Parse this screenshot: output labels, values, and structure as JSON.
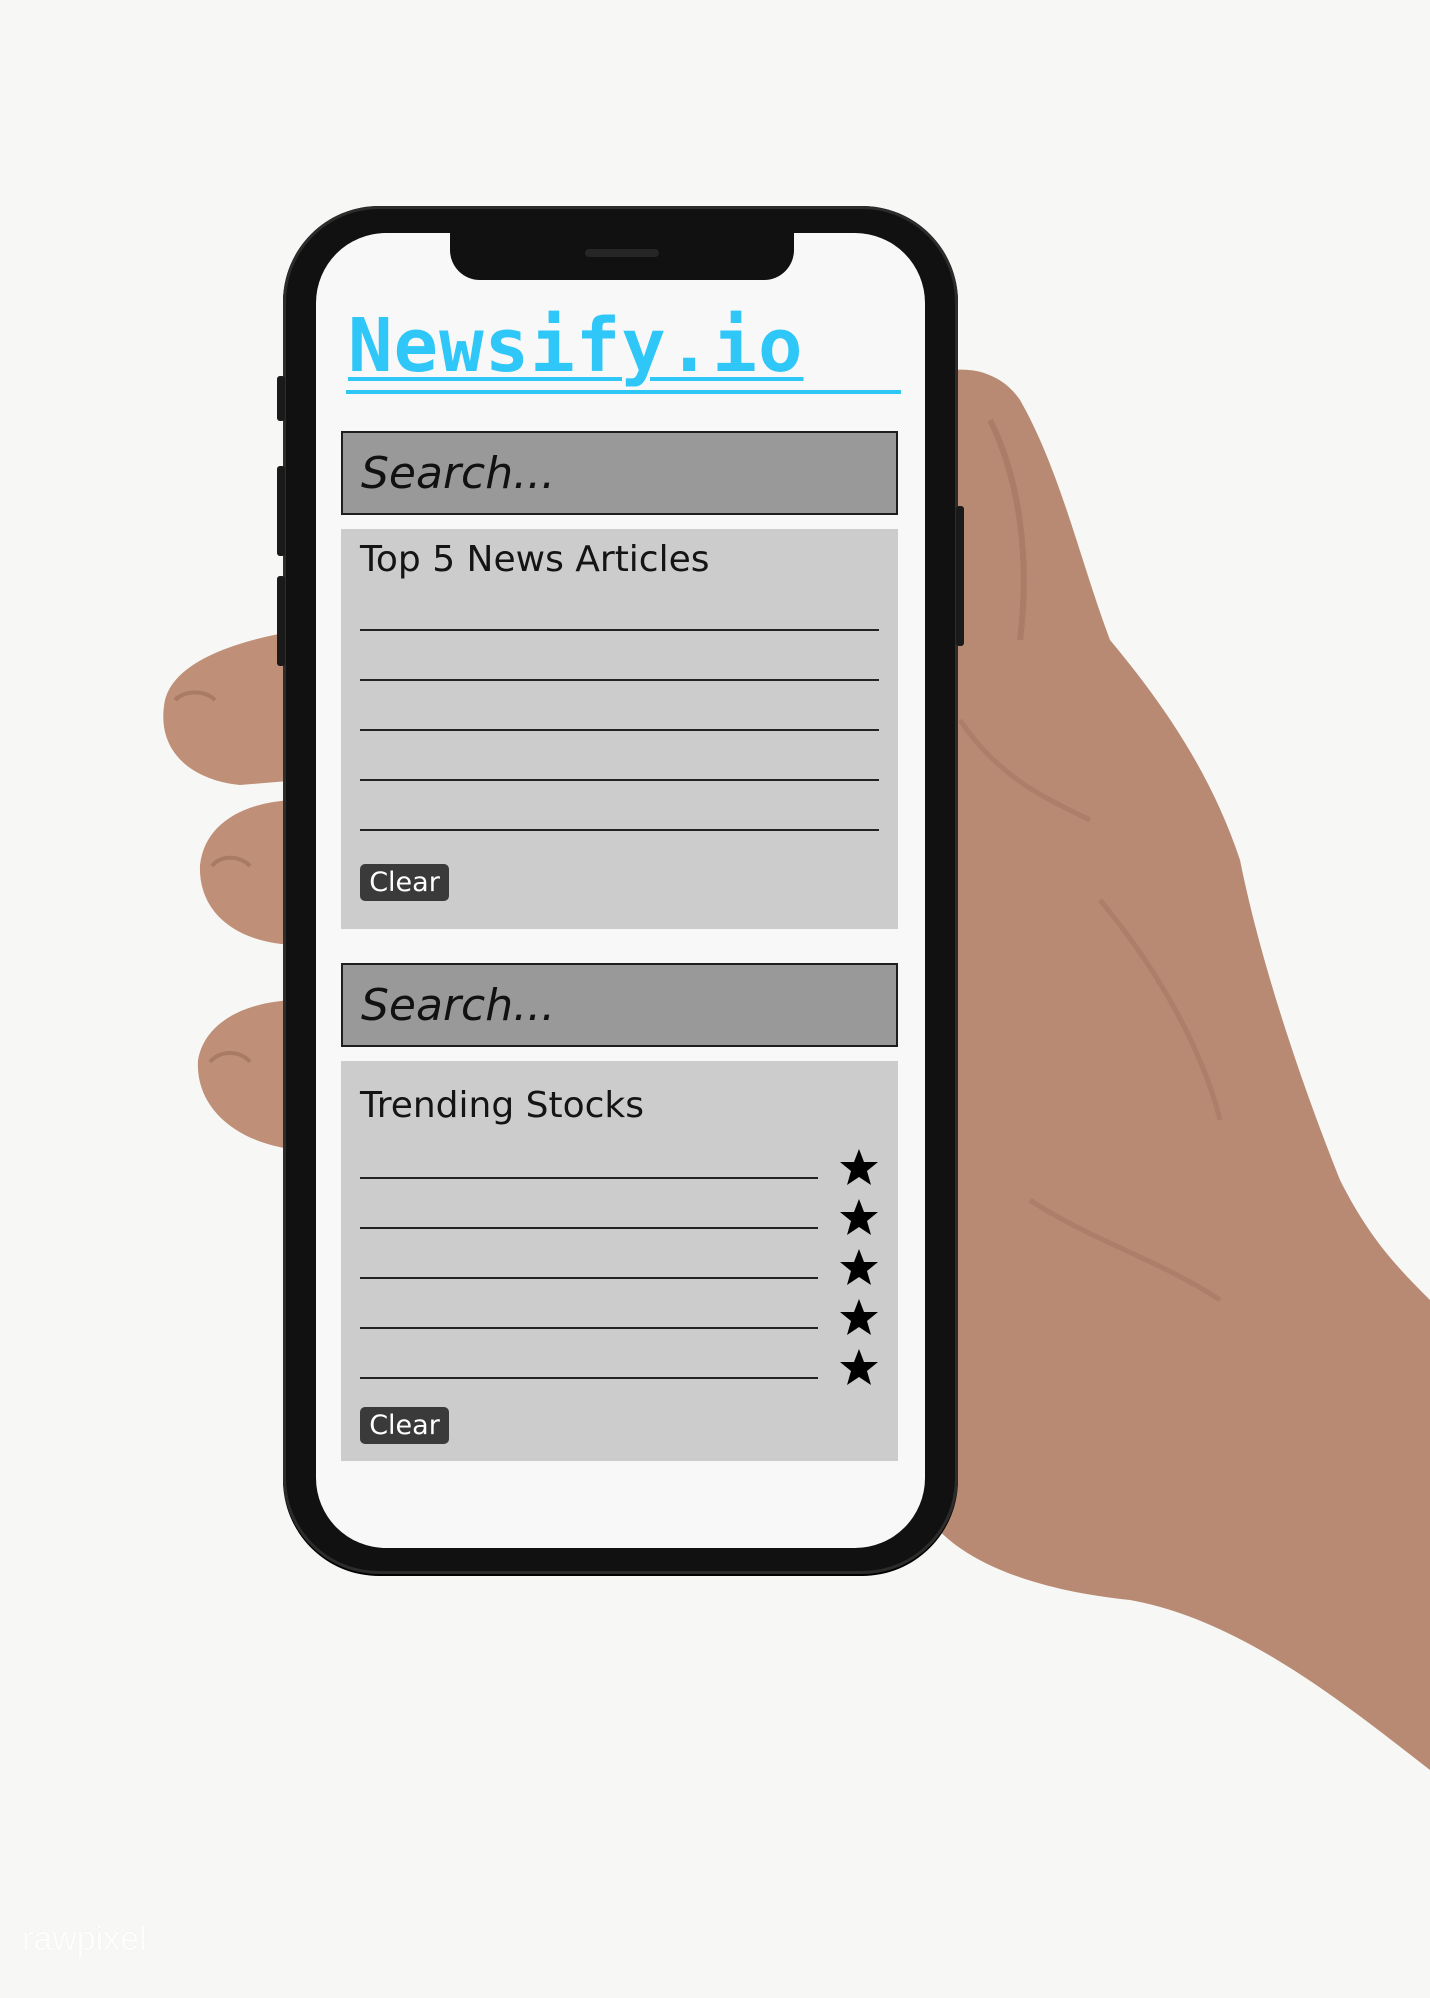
{
  "app": {
    "brand": "Newsify.io"
  },
  "news_section": {
    "search_placeholder": "Search...",
    "title": "Top 5 News Articles",
    "article_count": 5,
    "clear_label": "Clear"
  },
  "stocks_section": {
    "search_placeholder": "Search...",
    "title": "Trending Stocks",
    "stock_count": 5,
    "clear_label": "Clear"
  },
  "watermark": "rawpixel",
  "colors": {
    "brand": "#2ec7f7",
    "search_bg": "#999999",
    "panel_bg": "#cccccc",
    "button_bg": "#3a3a3a",
    "page_bg": "#f7f7f5"
  },
  "icons": {
    "favorite": "star-icon"
  }
}
